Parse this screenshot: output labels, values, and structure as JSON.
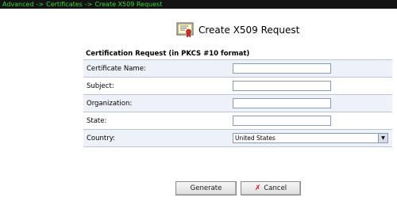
{
  "breadcrumb": {
    "items": [
      "Advanced",
      "Certificates",
      "Create X509 Request"
    ],
    "separator": "->"
  },
  "header": {
    "title": "Create X509 Request",
    "icon": "certificate-icon"
  },
  "form": {
    "heading": "Certification Request (in PKCS #10 format)",
    "fields": {
      "certificate_name": {
        "label": "Certificate Name:",
        "value": ""
      },
      "subject": {
        "label": "Subject:",
        "value": ""
      },
      "organization": {
        "label": "Organization:",
        "value": ""
      },
      "state": {
        "label": "State:",
        "value": ""
      },
      "country": {
        "label": "Country:",
        "value": "United States"
      }
    }
  },
  "buttons": {
    "generate": "Generate",
    "cancel": "Cancel"
  },
  "colors": {
    "breadcrumb_bg": "#141414",
    "breadcrumb_text": "#3bd43b",
    "row_alt_bg": "#eef1f8",
    "row_border": "#b9c4d8",
    "cancel_x": "#c81818"
  }
}
